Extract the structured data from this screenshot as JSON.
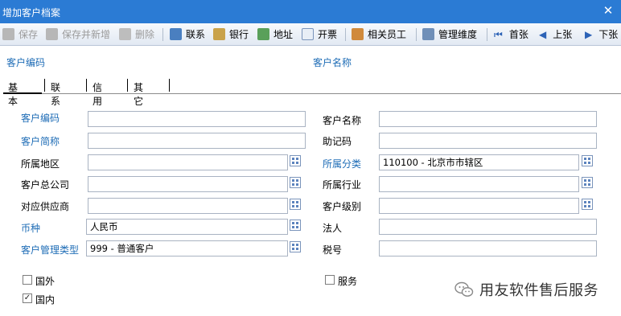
{
  "window": {
    "title": "增加客户档案",
    "close_glyph": "✕"
  },
  "toolbar": {
    "save": "保存",
    "save_new": "保存并新增",
    "delete": "删除",
    "contact": "联系",
    "bank": "银行",
    "address": "地址",
    "invoice": "开票",
    "staff": "相关员工",
    "dims": "管理维度",
    "first": "首张",
    "prev": "上张",
    "next": "下张"
  },
  "header": {
    "code_label": "客户编码",
    "name_label": "客户名称"
  },
  "tabs": [
    "基本",
    "联系",
    "信用",
    "其它"
  ],
  "form": {
    "code_label": "客户编码",
    "code_value": "",
    "name_label": "客户名称",
    "name_value": "",
    "short_label": "客户简称",
    "short_value": "",
    "mnemonic_label": "助记码",
    "mnemonic_value": "",
    "region_label": "所属地区",
    "region_value": "",
    "category_label": "所属分类",
    "category_value": "110100 - 北京市市辖区",
    "parent_label": "客户总公司",
    "parent_value": "",
    "industry_label": "所属行业",
    "industry_value": "",
    "supplier_label": "对应供应商",
    "supplier_value": "",
    "level_label": "客户级别",
    "level_value": "",
    "currency_label": "币种",
    "currency_value": "人民币",
    "legal_label": "法人",
    "legal_value": "",
    "mgmt_type_label": "客户管理类型",
    "mgmt_type_value": "999 - 普通客户",
    "tax_label": "税号",
    "tax_value": ""
  },
  "checkboxes": {
    "foreign_label": "国外",
    "foreign_checked": false,
    "domestic_label": "国内",
    "domestic_checked": true,
    "service_label": "服务",
    "service_checked": false
  },
  "watermark": {
    "text": "用友软件售后服务"
  },
  "colors": {
    "titlebar": "#2b7bd4",
    "label_blue": "#1e6cb6"
  }
}
